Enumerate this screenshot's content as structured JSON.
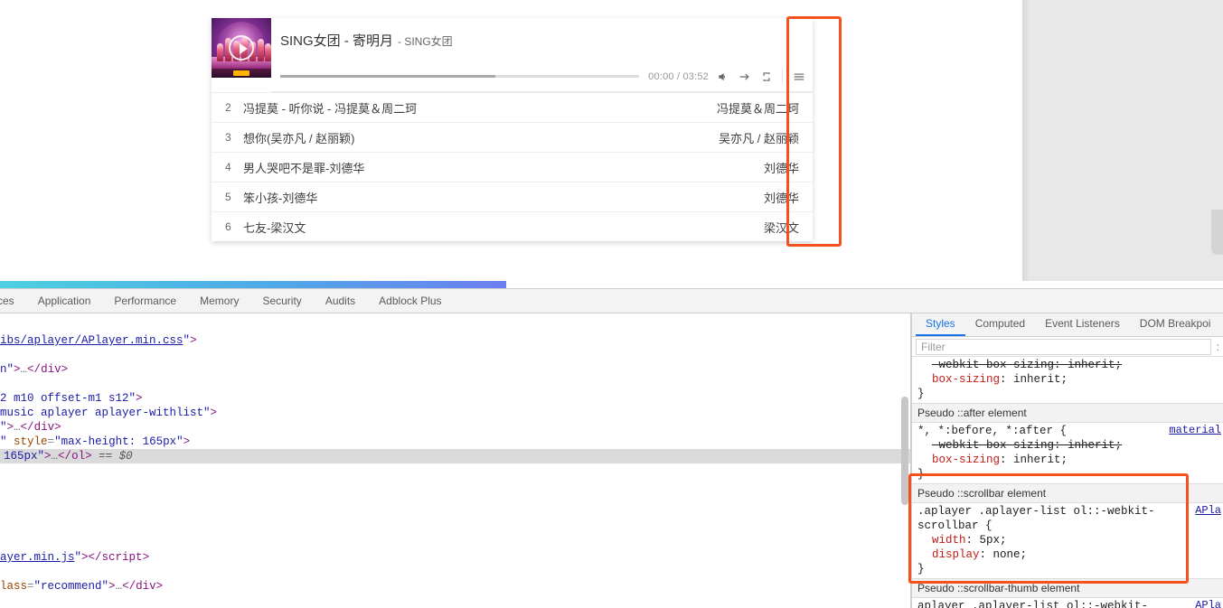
{
  "player": {
    "title": "SING女团 - 寄明月",
    "author": "- SING女团",
    "time": "00:00 / 03:52",
    "icons": {
      "volume": "volume-icon",
      "order": "order-arrow-icon",
      "loop": "loop-icon",
      "menu": "playlist-menu-icon",
      "play": "play-icon"
    },
    "progress": {
      "loaded_percent": 60,
      "played_percent": 0
    },
    "playlist": [
      {
        "index": "2",
        "title": "冯提莫 - 听你说 - 冯提莫＆周二珂",
        "author": "冯提莫＆周二珂"
      },
      {
        "index": "3",
        "title": "想你(吴亦凡 / 赵丽颖)",
        "author": "吴亦凡 / 赵丽颖"
      },
      {
        "index": "4",
        "title": "男人哭吧不是罪-刘德华",
        "author": "刘德华"
      },
      {
        "index": "5",
        "title": "笨小孩-刘德华",
        "author": "刘德华"
      },
      {
        "index": "6",
        "title": "七友-梁汉文",
        "author": "梁汉文"
      }
    ]
  },
  "devtools": {
    "tabs": [
      {
        "label": "ces",
        "clipped": true
      },
      {
        "label": "Application"
      },
      {
        "label": "Performance"
      },
      {
        "label": "Memory"
      },
      {
        "label": "Security"
      },
      {
        "label": "Audits"
      },
      {
        "label": "Adblock Plus"
      }
    ],
    "dom_lines": [
      {
        "html": "<span class=\"tk-link\">ibs/aplayer/APlayer.min.css</span><span class=\"tk-attrv\">\"</span><span class=\"tk-angle\">&gt;</span>",
        "pad": 0
      },
      {
        "spacer": true
      },
      {
        "html": "<span class=\"tk-attrv\">n\"</span><span class=\"tk-angle\">&gt;</span><span class=\"tk-dots\">…</span><span class=\"tk-angle\">&lt;/</span><span class=\"tk-tag\">div</span><span class=\"tk-angle\">&gt;</span>",
        "pad": 0
      },
      {
        "spacer": true
      },
      {
        "html": "<span class=\"tk-attrv\">2 m10 offset-m1 s12\"</span><span class=\"tk-angle\">&gt;</span>",
        "pad": 0
      },
      {
        "html": "<span class=\"tk-attrv\">music aplayer aplayer-withlist\"</span><span class=\"tk-angle\">&gt;</span>",
        "pad": 0
      },
      {
        "html": "<span class=\"tk-attrv\">\"</span><span class=\"tk-angle\">&gt;</span><span class=\"tk-dots\">…</span><span class=\"tk-angle\">&lt;/</span><span class=\"tk-tag\">div</span><span class=\"tk-angle\">&gt;</span>",
        "pad": 0
      },
      {
        "html": "<span class=\"tk-attrv\">\"</span> <span class=\"tk-attr\">style</span><span class=\"tk-punct\">=</span><span class=\"tk-attrv\">\"max-height: 165px\"</span><span class=\"tk-angle\">&gt;</span>",
        "pad": 0
      },
      {
        "html": "<span class=\"tk-attrv\">165px\"</span><span class=\"tk-angle\">&gt;</span><span class=\"tk-dots\">…</span><span class=\"tk-angle\">&lt;/</span><span class=\"tk-tag\">ol</span><span class=\"tk-angle\">&gt;</span> <span class=\"tk-dollar\">== $0</span>",
        "pad": 4,
        "selected": true
      },
      {
        "spacer": true
      },
      {
        "spacer": true
      },
      {
        "spacer": true
      },
      {
        "spacer": true
      },
      {
        "spacer": true
      },
      {
        "spacer": true
      },
      {
        "html": "<span class=\"tk-link\">ayer.min.js</span><span class=\"tk-attrv\">\"</span><span class=\"tk-angle\">&gt;&lt;/</span><span class=\"tk-tag\">script</span><span class=\"tk-angle\">&gt;</span>",
        "pad": 0
      },
      {
        "spacer": true
      },
      {
        "html": "<span class=\"tk-attr\">lass</span><span class=\"tk-punct\">=</span><span class=\"tk-attrv\">\"recommend\"</span><span class=\"tk-angle\">&gt;</span><span class=\"tk-dots\">…</span><span class=\"tk-angle\">&lt;/</span><span class=\"tk-tag\">div</span><span class=\"tk-angle\">&gt;</span>",
        "pad": 0
      }
    ]
  },
  "styles": {
    "tabs": [
      {
        "label": "Styles",
        "active": true
      },
      {
        "label": "Computed",
        "active": false
      },
      {
        "label": "Event Listeners",
        "active": false
      },
      {
        "label": "DOM Breakpoi",
        "active": false
      }
    ],
    "filter_placeholder": "Filter",
    "filter_value": "",
    "filter_extra": ":",
    "sections": [
      {
        "type": "rule_tail",
        "lines": [
          {
            "text": "-webkit-box-sizing: inherit;",
            "strike": true
          },
          {
            "text": "box-sizing: inherit;",
            "strike": false
          },
          {
            "text": "}",
            "close": true
          }
        ]
      },
      {
        "type": "pseudo_header",
        "label": "Pseudo ::after element"
      },
      {
        "type": "rule",
        "selector": "*, *:before, *:after {",
        "origin": "material",
        "lines": [
          {
            "text": "-webkit-box-sizing: inherit;",
            "strike": true
          },
          {
            "text": "box-sizing: inherit;",
            "strike": false
          },
          {
            "text": "}",
            "close": true
          }
        ]
      },
      {
        "type": "pseudo_header",
        "label": "Pseudo ::scrollbar element",
        "highlighted": true
      },
      {
        "type": "rule",
        "selector": ".aplayer .aplayer-list ol::-webkit-",
        "selector2": "scrollbar {",
        "origin": "APla",
        "highlighted": true,
        "lines": [
          {
            "prop": "width",
            "value": "5px"
          },
          {
            "prop": "display",
            "value": "none"
          },
          {
            "text": "}",
            "close": true
          }
        ]
      },
      {
        "type": "pseudo_header",
        "label": "Pseudo ::scrollbar-thumb element"
      },
      {
        "type": "rule",
        "selector": "aplayer .aplayer-list ol::-webkit-",
        "origin": "APla",
        "clipped": true,
        "lines": []
      }
    ]
  },
  "annotations": {
    "color": "#f4511e",
    "boxes": [
      {
        "name": "playlist-scrollbar-region"
      },
      {
        "name": "scrollbar-css-rule-region"
      }
    ]
  }
}
